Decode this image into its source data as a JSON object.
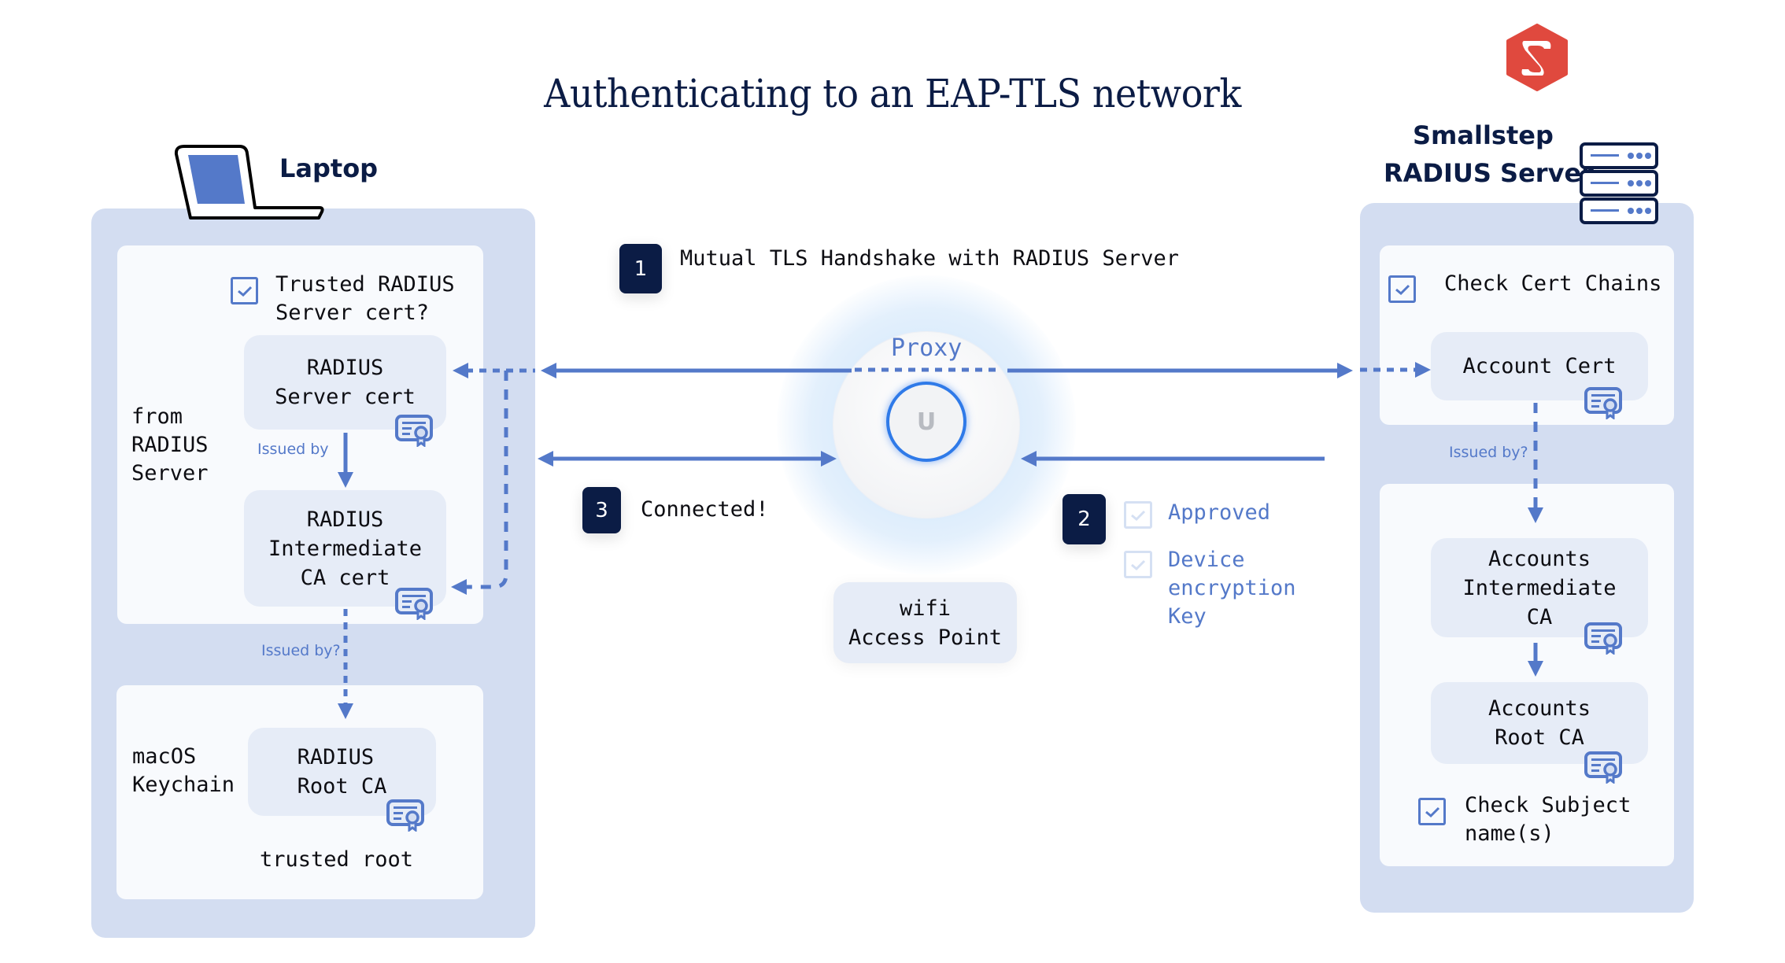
{
  "title": "Authenticating to an EAP-TLS network",
  "colors": {
    "accent": "#5479c9",
    "navy": "#0b1c45",
    "panel": "#d3ddf1",
    "card": "#f8fafd",
    "cert_box": "#e6ecf7",
    "brand_red": "#e0493e",
    "led_blue": "#2f7ae8"
  },
  "laptop": {
    "heading": "Laptop",
    "icon": "laptop-icon",
    "check_trusted": {
      "checked": true,
      "label": "Trusted RADIUS\nServer cert?"
    },
    "from_label": "from\nRADIUS\nServer",
    "server_cert": {
      "label": "RADIUS\nServer cert",
      "icon": "certificate-icon"
    },
    "issued_by_label": "Issued by",
    "intermediate_cert": {
      "label": "RADIUS\nIntermediate\nCA cert",
      "icon": "certificate-icon"
    },
    "issued_by_q_label": "Issued by?",
    "keychain_label": "macOS\nKeychain",
    "root_cert": {
      "label": "RADIUS\nRoot CA",
      "icon": "certificate-icon"
    },
    "trusted_root_label": "trusted root"
  },
  "center": {
    "step1": {
      "number": "1",
      "label": "Mutual TLS Handshake with RADIUS Server"
    },
    "proxy_label": "Proxy",
    "device_icon": "access-point-icon",
    "device_logo": "U",
    "step3": {
      "number": "3",
      "label": "Connected!"
    },
    "step2": {
      "number": "2",
      "items": [
        {
          "checked": true,
          "label": "Approved"
        },
        {
          "checked": true,
          "label": "Device\nencryption\nKey"
        }
      ]
    },
    "access_point_label": "wifi\nAccess Point"
  },
  "server": {
    "brand_logo": "smallstep-logo",
    "heading_line1": "Smallstep",
    "heading_line2": "RADIUS Server",
    "icon": "server-rack-icon",
    "check_chains": {
      "checked": true,
      "label": "Check Cert Chains"
    },
    "account_cert": {
      "label": "Account Cert",
      "icon": "certificate-icon"
    },
    "issued_by_q_label": "Issued by?",
    "intermediate_ca": {
      "label": "Accounts\nIntermediate\nCA",
      "icon": "certificate-icon"
    },
    "root_ca": {
      "label": "Accounts\nRoot CA",
      "icon": "certificate-icon"
    },
    "check_subject": {
      "checked": true,
      "label": "Check Subject\nname(s)"
    }
  }
}
